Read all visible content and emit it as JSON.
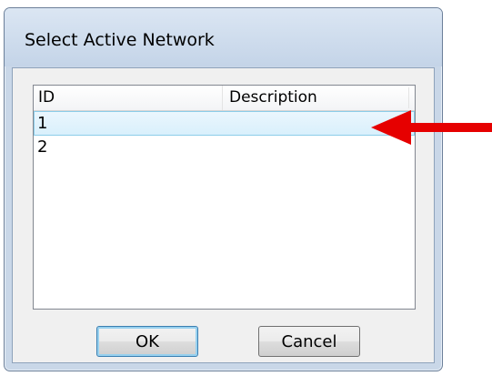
{
  "window": {
    "title": "Select Active Network"
  },
  "listview": {
    "columns": [
      "ID",
      "Description"
    ],
    "rows": [
      {
        "id": "1",
        "description": "",
        "selected": true
      },
      {
        "id": "2",
        "description": "",
        "selected": false
      }
    ]
  },
  "buttons": {
    "ok_label": "OK",
    "cancel_label": "Cancel"
  },
  "annotation": {
    "arrow_color": "#e60000",
    "points_to": "row 1"
  },
  "colors": {
    "selection_border": "#8ccde9",
    "frame": "#c9d7e8"
  }
}
